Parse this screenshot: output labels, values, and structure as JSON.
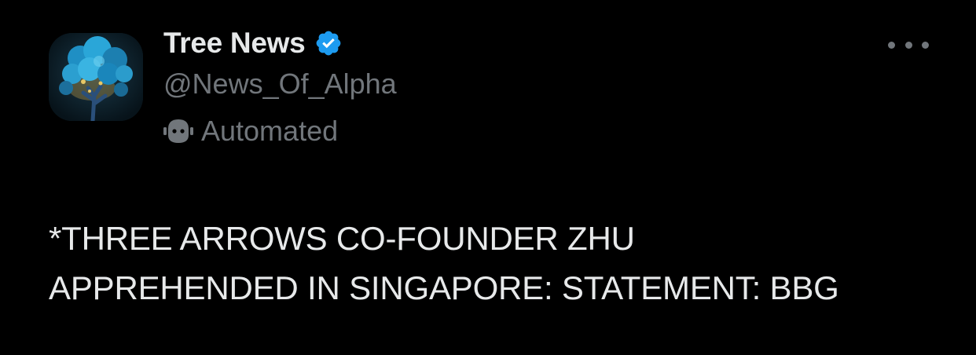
{
  "author": {
    "display_name": "Tree News",
    "handle": "@News_Of_Alpha",
    "label": "Automated",
    "avatar_icon": "blue-tree-avatar",
    "verified_icon": "verified-badge-icon",
    "label_icon": "bot-icon"
  },
  "tweet": {
    "lines": [
      "*THREE ARROWS CO-FOUNDER ZHU",
      "APPREHENDED IN SINGAPORE: STATEMENT: BBG"
    ]
  },
  "actions": {
    "more_icon": "more-options-icon"
  },
  "colors": {
    "background": "#000000",
    "primary_text": "#e7e9ea",
    "secondary_text": "#71767b",
    "verified": "#1d9bf0"
  }
}
